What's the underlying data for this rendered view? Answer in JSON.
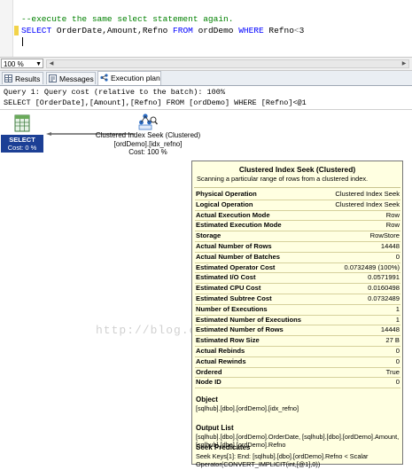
{
  "editor": {
    "comment_line": "--execute the same select statement again.",
    "sql": {
      "kw_select": "SELECT",
      "cols": "OrderDate,Amount,Refno",
      "kw_from": "FROM",
      "table": "ordDemo",
      "kw_where": "WHERE",
      "col": "Refno",
      "op": "<",
      "val": "3"
    }
  },
  "zoom": {
    "value": "100 %"
  },
  "tabs": [
    {
      "label": "Results",
      "icon": "grid-icon"
    },
    {
      "label": "Messages",
      "icon": "messages-icon"
    },
    {
      "label": "Execution plan",
      "icon": "execution-plan-icon",
      "active": true
    }
  ],
  "plan": {
    "query_header": "Query 1: Query cost (relative to the batch): 100%",
    "query_text": "SELECT [OrderDate],[Amount],[Refno] FROM [ordDemo] WHERE [Refno]<@1",
    "select_node": {
      "label": "SELECT",
      "cost": "Cost: 0 %"
    },
    "seek_node": {
      "line1": "Clustered Index Seek (Clustered)",
      "line2": "[ordDemo].[idx_refno]",
      "line3": "Cost: 100 %"
    }
  },
  "tooltip": {
    "title": "Clustered Index Seek (Clustered)",
    "description": "Scanning a particular range of rows from a clustered index.",
    "properties": [
      {
        "name": "Physical Operation",
        "value": "Clustered Index Seek"
      },
      {
        "name": "Logical Operation",
        "value": "Clustered Index Seek"
      },
      {
        "name": "Actual Execution Mode",
        "value": "Row"
      },
      {
        "name": "Estimated Execution Mode",
        "value": "Row"
      },
      {
        "name": "Storage",
        "value": "RowStore"
      },
      {
        "name": "Actual Number of Rows",
        "value": "14448"
      },
      {
        "name": "Actual Number of Batches",
        "value": "0"
      },
      {
        "name": "Estimated Operator Cost",
        "value": "0.0732489 (100%)"
      },
      {
        "name": "Estimated I/O Cost",
        "value": "0.0571991"
      },
      {
        "name": "Estimated CPU Cost",
        "value": "0.0160498"
      },
      {
        "name": "Estimated Subtree Cost",
        "value": "0.0732489"
      },
      {
        "name": "Number of Executions",
        "value": "1"
      },
      {
        "name": "Estimated Number of Executions",
        "value": "1"
      },
      {
        "name": "Estimated Number of Rows",
        "value": "14448"
      },
      {
        "name": "Estimated Row Size",
        "value": "27 B"
      },
      {
        "name": "Actual Rebinds",
        "value": "0"
      },
      {
        "name": "Actual Rewinds",
        "value": "0"
      },
      {
        "name": "Ordered",
        "value": "True"
      },
      {
        "name": "Node ID",
        "value": "0"
      }
    ],
    "object": {
      "heading": "Object",
      "text": "[sqlhub].[dbo].[ordDemo].[idx_refno]"
    },
    "output_list": {
      "heading": "Output List",
      "text": "[sqlhub].[dbo].[ordDemo].OrderDate, [sqlhub].[dbo].[ordDemo].Amount, [sqlhub].[dbo].[ordDemo].Refno"
    },
    "seek_predicates": {
      "heading": "Seek Predicates",
      "text": "Seek Keys[1]: End: [sqlhub].[dbo].[ordDemo].Refno < Scalar Operator(CONVERT_IMPLICIT(int,[@1],0))"
    }
  },
  "watermark": "http://blog.csdn.net/zolchen",
  "colors": {
    "select_node_bg": "#1c3f95",
    "tooltip_bg": "#ffffe1",
    "keyword": "#0000ff",
    "comment": "#008000"
  }
}
